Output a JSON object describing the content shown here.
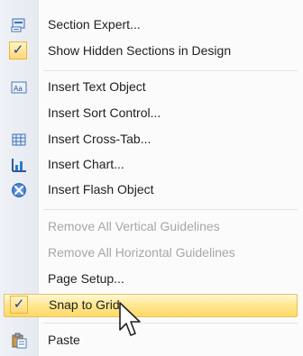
{
  "menu": {
    "items": [
      {
        "label": "Section Expert...",
        "icon": "section-expert-icon"
      },
      {
        "label": "Show Hidden Sections in Design",
        "checked": true
      },
      {
        "label": "Insert Text Object",
        "icon": "text-object-icon"
      },
      {
        "label": "Insert Sort Control...",
        "icon": ""
      },
      {
        "label": "Insert Cross-Tab...",
        "icon": "cross-tab-icon"
      },
      {
        "label": "Insert Chart...",
        "icon": "chart-icon"
      },
      {
        "label": "Insert Flash Object",
        "icon": "flash-object-icon"
      },
      {
        "label": "Remove All Vertical Guidelines",
        "disabled": true
      },
      {
        "label": "Remove All Horizontal Guidelines",
        "disabled": true
      },
      {
        "label": "Page Setup..."
      },
      {
        "label": "Snap to Grid",
        "checked": true,
        "highlighted": true
      },
      {
        "label": "Paste",
        "icon": "paste-icon"
      }
    ],
    "check_glyph": "✓"
  },
  "colors": {
    "highlight": "#ffe893",
    "disabled_text": "#a7a7a7",
    "check": "#1a3c8c"
  }
}
